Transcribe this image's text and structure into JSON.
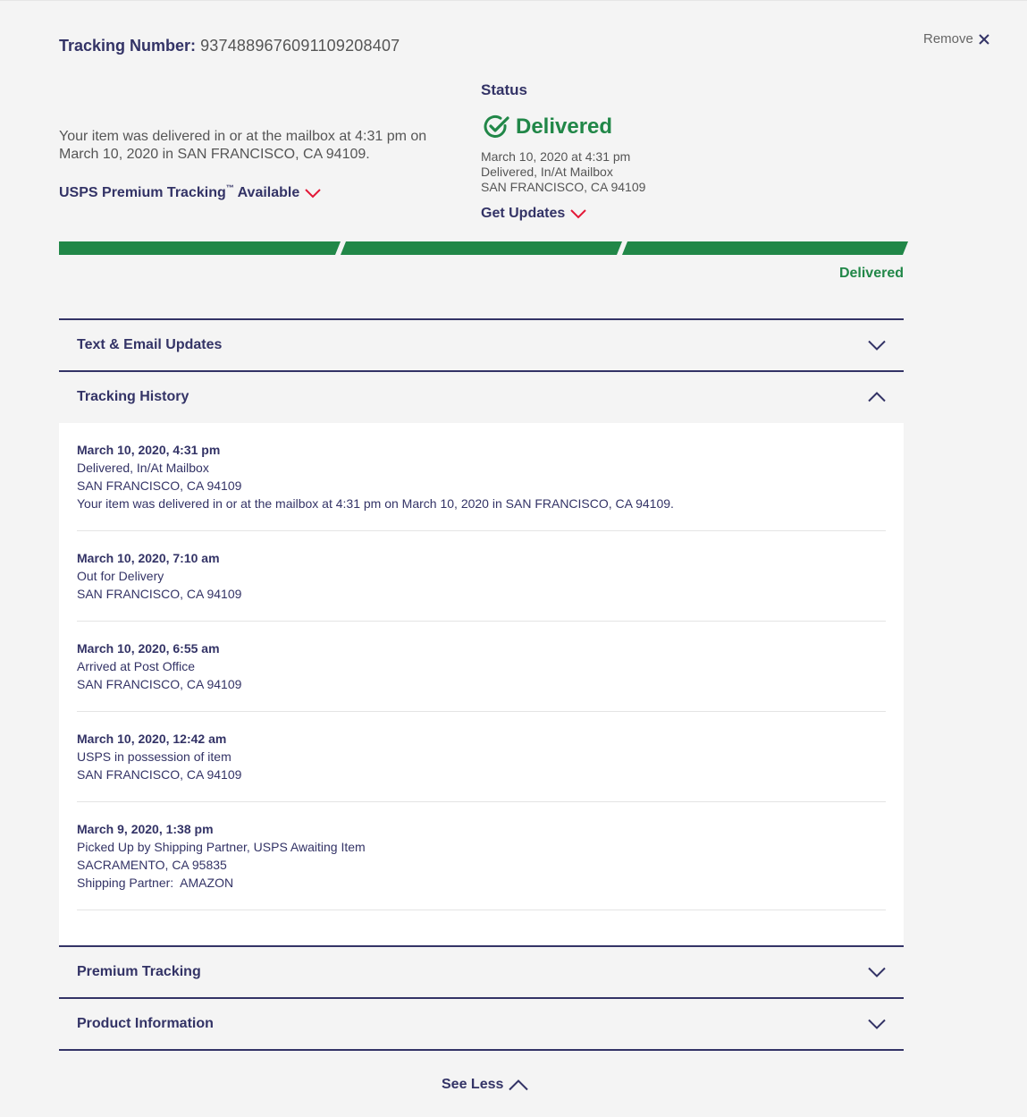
{
  "tracking": {
    "label": "Tracking Number:",
    "number": "9374889676091109208407"
  },
  "remove_label": "Remove",
  "summary_text": "Your item was delivered in or at the mailbox at 4:31 pm on March 10, 2020 in SAN FRANCISCO, CA 94109.",
  "premium": {
    "label_before": "USPS Premium Tracking",
    "trademark": "™",
    "label_after": " Available"
  },
  "status": {
    "heading": "Status",
    "value": "Delivered",
    "date": "March 10, 2020 at 4:31 pm",
    "event": "Delivered, In/At Mailbox",
    "location": "SAN FRANCISCO, CA 94109",
    "get_updates": "Get Updates"
  },
  "progress": {
    "label": "Delivered",
    "segments_complete": 3,
    "segments_total": 3
  },
  "accordions": {
    "text_email": "Text & Email Updates",
    "history": "Tracking History",
    "premium": "Premium Tracking",
    "product": "Product Information"
  },
  "history": [
    {
      "time": "March 10, 2020, 4:31 pm",
      "lines": [
        "Delivered, In/At Mailbox",
        "SAN FRANCISCO, CA 94109",
        "Your item was delivered in or at the mailbox at 4:31 pm on March 10, 2020 in SAN FRANCISCO, CA 94109."
      ]
    },
    {
      "time": "March 10, 2020, 7:10 am",
      "lines": [
        "Out for Delivery",
        "SAN FRANCISCO, CA 94109"
      ]
    },
    {
      "time": "March 10, 2020, 6:55 am",
      "lines": [
        "Arrived at Post Office",
        "SAN FRANCISCO, CA 94109"
      ]
    },
    {
      "time": "March 10, 2020, 12:42 am",
      "lines": [
        "USPS in possession of item",
        "SAN FRANCISCO, CA 94109"
      ]
    },
    {
      "time": "March 9, 2020, 1:38 pm",
      "lines": [
        "Picked Up by Shipping Partner, USPS Awaiting Item",
        "SACRAMENTO, CA 95835",
        "Shipping Partner:  AMAZON"
      ]
    }
  ],
  "see_less": "See Less",
  "colors": {
    "navy": "#333366",
    "green": "#218748",
    "red": "#e31837"
  },
  "icons": {
    "remove": "close-icon",
    "status": "check-circle-icon",
    "expand": "chevron-down-icon",
    "collapse": "chevron-up-icon"
  }
}
